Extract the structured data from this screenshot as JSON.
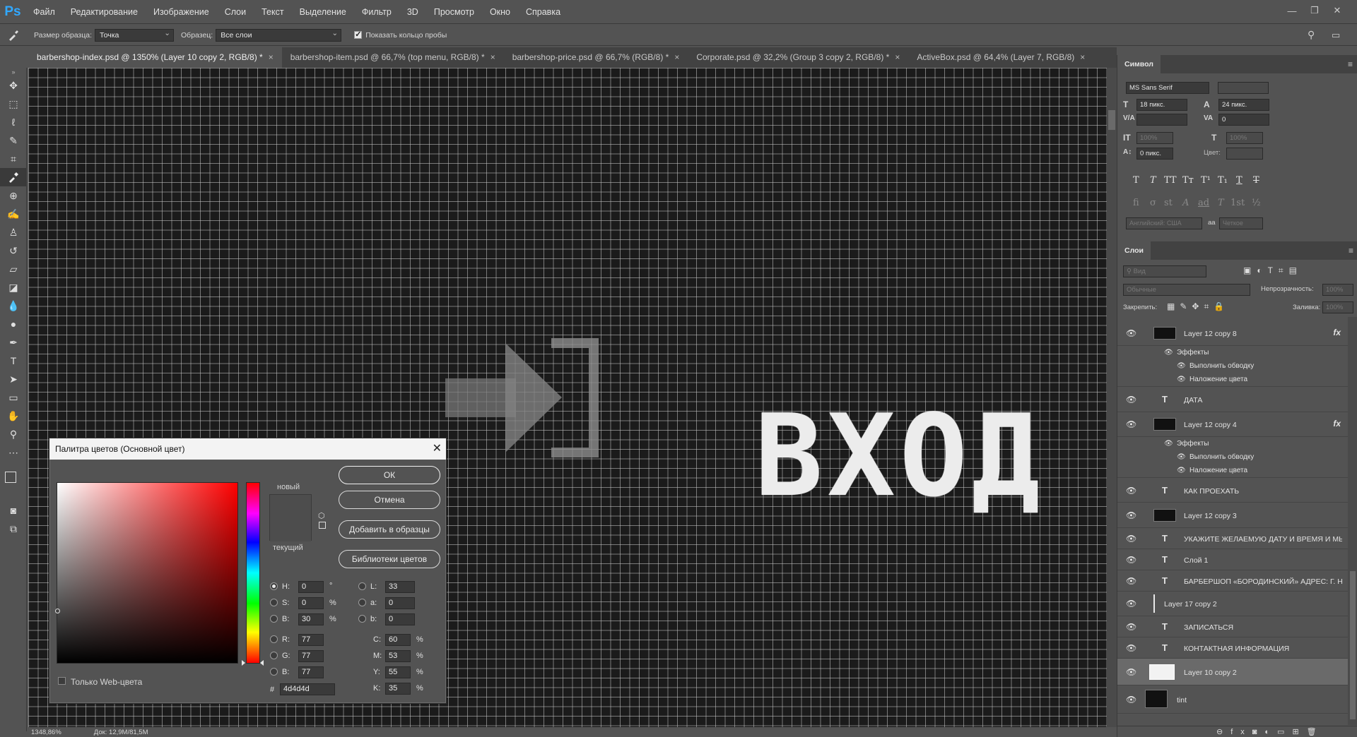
{
  "app": {
    "logo": "Ps"
  },
  "menu": [
    "Файл",
    "Редактирование",
    "Изображение",
    "Слои",
    "Текст",
    "Выделение",
    "Фильтр",
    "3D",
    "Просмотр",
    "Окно",
    "Справка"
  ],
  "options": {
    "sample_size_label": "Размер образца:",
    "sample_size_value": "Точка",
    "sample_label": "Образец:",
    "sample_value": "Все слои",
    "show_ring_label": "Показать кольцо пробы"
  },
  "tabs": [
    {
      "label": "barbershop-index.psd @ 1350% (Layer 10 copy 2, RGB/8) *",
      "active": true
    },
    {
      "label": "barbershop-item.psd @ 66,7% (top menu, RGB/8) *",
      "active": false
    },
    {
      "label": "barbershop-price.psd @ 66,7% (RGB/8) *",
      "active": false
    },
    {
      "label": "Corporate.psd @ 32,2% (Group 3 copy 2, RGB/8) *",
      "active": false
    },
    {
      "label": "ActiveBox.psd @ 64,4% (Layer 7, RGB/8)",
      "active": false
    }
  ],
  "tab_close": "×",
  "canvas": {
    "text": "ВХОД"
  },
  "status": {
    "zoom": "1348,86%",
    "doc": "Док: 12,9M/81,5M"
  },
  "color_picker": {
    "title": "Палитра цветов (Основной цвет)",
    "new_label": "новый",
    "current_label": "текущий",
    "ok": "ОК",
    "cancel": "Отмена",
    "add_swatches": "Добавить в образцы",
    "libraries": "Библиотеки цветов",
    "web_only": "Только Web-цвета",
    "new_color": "#4d4d4d",
    "current_color": "#4d4d4d",
    "H": "0",
    "S": "0",
    "B": "30",
    "R": "77",
    "G": "77",
    "Bv": "77",
    "L": "33",
    "a": "0",
    "b": "0",
    "C": "60",
    "M": "53",
    "Y": "55",
    "K": "35",
    "hex": "4d4d4d",
    "deg": "°",
    "pct": "%"
  },
  "symbol_panel": {
    "title": "Символ",
    "font": "MS Sans Serif",
    "size": "18 пикс.",
    "leading": "24 пикс.",
    "tracking": "0",
    "vscale": "100%",
    "hscale": "100%",
    "baseline": "0 пикс.",
    "color_label": "Цвет:",
    "language": "Английский: США",
    "aa_label": "aa",
    "aa": "Четкое",
    "styles": [
      "T",
      "T",
      "TT",
      "Tт",
      "T¹",
      "T₁",
      "T",
      "T"
    ],
    "opentype": [
      "fi",
      "σ",
      "st",
      "A",
      "ad",
      "T",
      "1st",
      "½"
    ]
  },
  "layers_panel": {
    "title": "Слои",
    "search_placeholder": "Вид",
    "blend_mode": "Обычные",
    "opacity_label": "Непрозрачность:",
    "opacity": "100%",
    "lock_label": "Закрепить:",
    "fill_label": "Заливка:",
    "fill": "100%",
    "effects_label": "Эффекты",
    "stroke_label": "Выполнить обводку",
    "overlay_label": "Наложение цвета",
    "fx": "fx",
    "layers": [
      {
        "name": "Layer 12 copy 8",
        "kind": "pixel",
        "fx": true
      },
      {
        "name": "ДАТА",
        "kind": "text"
      },
      {
        "name": "Layer 12 copy 4",
        "kind": "pixel",
        "fx": true
      },
      {
        "name": "КАК ПРОЕХАТЬ",
        "kind": "text"
      },
      {
        "name": "Layer 12 copy 3",
        "kind": "pixel"
      },
      {
        "name": "УКАЖИТЕ ЖЕЛАЕМУЮ ДАТУ И ВРЕМЯ И МЫ...",
        "kind": "text"
      },
      {
        "name": "Слой 1",
        "kind": "text"
      },
      {
        "name": "БАРБЕРШОП «БОРОДИНСКИЙ» АДРЕС: Г. Н...",
        "kind": "text"
      },
      {
        "name": "Layer 17 copy 2",
        "kind": "pixel"
      },
      {
        "name": "ЗАПИСАТЬСЯ",
        "kind": "text"
      },
      {
        "name": "КОНТАКТНАЯ ИНФОРМАЦИЯ",
        "kind": "text"
      },
      {
        "name": "Layer 10 copy 2",
        "kind": "pixel",
        "selected": true
      },
      {
        "name": "tint",
        "kind": "pixel"
      }
    ]
  }
}
